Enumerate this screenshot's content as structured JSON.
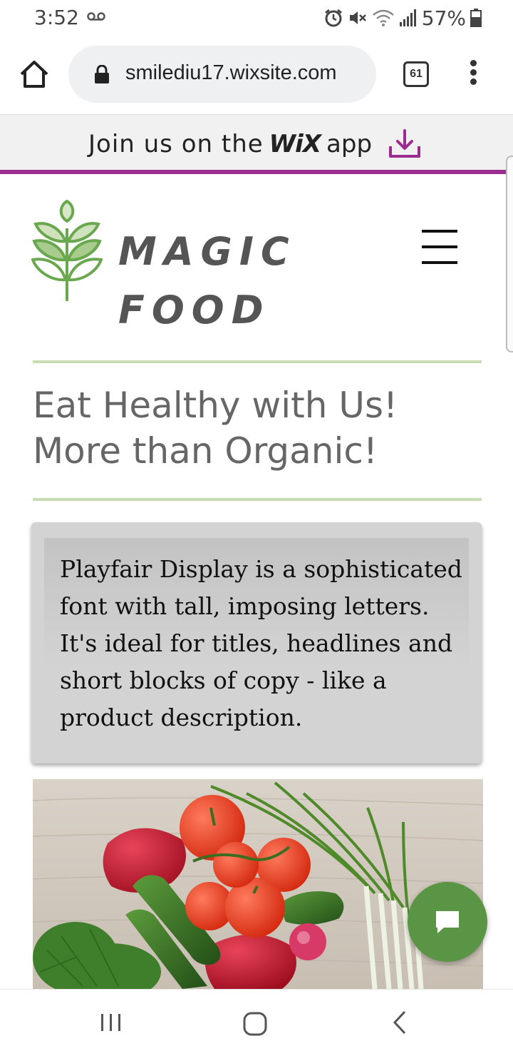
{
  "status_bar": {
    "time": "3:52",
    "battery": "57%",
    "icons": [
      "voicemail-icon",
      "alarm-icon",
      "mute-icon",
      "wifi-icon",
      "signal-icon",
      "battery-icon"
    ]
  },
  "browser": {
    "url": "smilediu17.wixsite.com",
    "tab_count": "61",
    "icons": [
      "home-icon",
      "lock-icon",
      "tabs-icon",
      "more-vert-icon"
    ]
  },
  "wix_banner": {
    "prefix": "Join us on the",
    "logo": "WiX",
    "suffix": "app",
    "accent_color": "#9b2d8e"
  },
  "site": {
    "logo_line1": "MAGIC",
    "logo_line2": "FOOD",
    "headline_line1": "Eat Healthy with Us!",
    "headline_line2": "More than Organic!",
    "description": "Playfair Display is a sophisticated font with tall, imposing letters. It's ideal for titles, headlines and short blocks of copy - like a product description.",
    "brand_green": "#5a9445",
    "rule_color": "#c8dcb4"
  },
  "nav_bar": {
    "icons": [
      "recent-apps-icon",
      "home-nav-icon",
      "back-icon"
    ]
  }
}
